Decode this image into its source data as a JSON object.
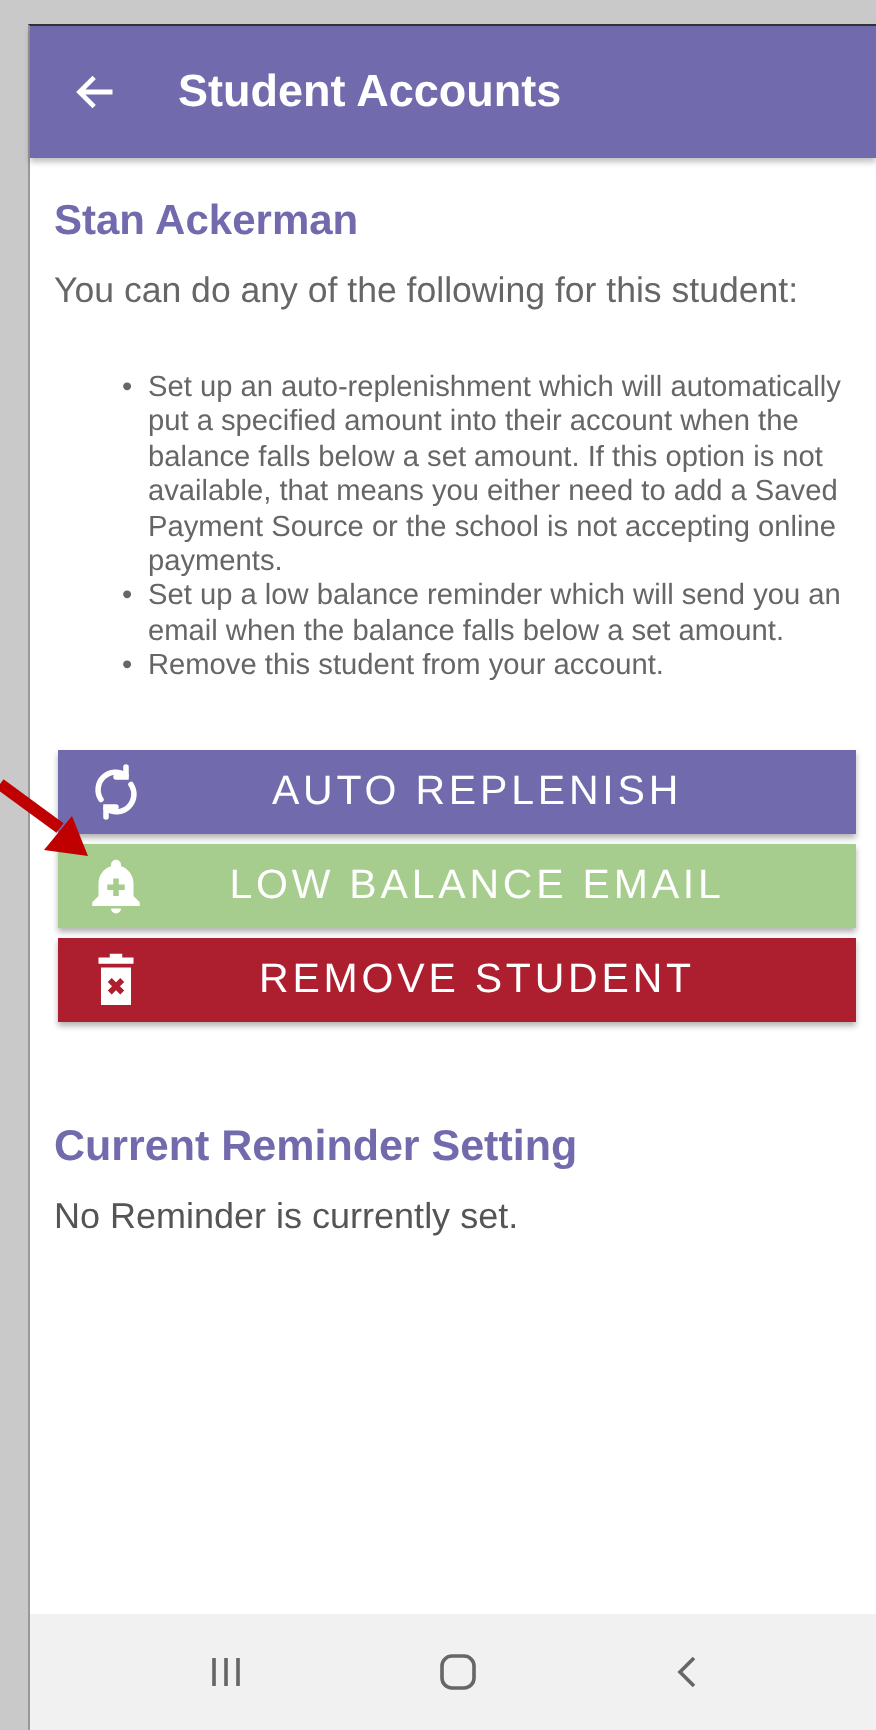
{
  "app_bar": {
    "title": "Student Accounts"
  },
  "student": {
    "name": "Stan Ackerman",
    "intro": "You can do any of the following for this student:"
  },
  "options": [
    {
      "marker": "•",
      "text": "Set up an auto-replenishment which will automatically put a specified amount into their account when the balance falls below a set amount. If this option is not available, that means you either need to add a Saved Payment Source or the school is not accepting online payments."
    },
    {
      "marker": "•",
      "text": "Set up a low balance reminder which will send you an email when the balance falls below a set amount."
    },
    {
      "marker": "•",
      "text": "Remove this student from your account."
    }
  ],
  "actions": [
    {
      "kind": "replenish",
      "label": "AUTO REPLENISH",
      "color": "#716bae"
    },
    {
      "kind": "reminder",
      "label": "LOW BALANCE EMAIL",
      "color": "#a6cd8d"
    },
    {
      "kind": "remove",
      "label": "REMOVE STUDENT",
      "color": "#ad1e2e"
    }
  ],
  "reminder": {
    "title": "Current Reminder Setting",
    "status": "No Reminder is currently set."
  }
}
